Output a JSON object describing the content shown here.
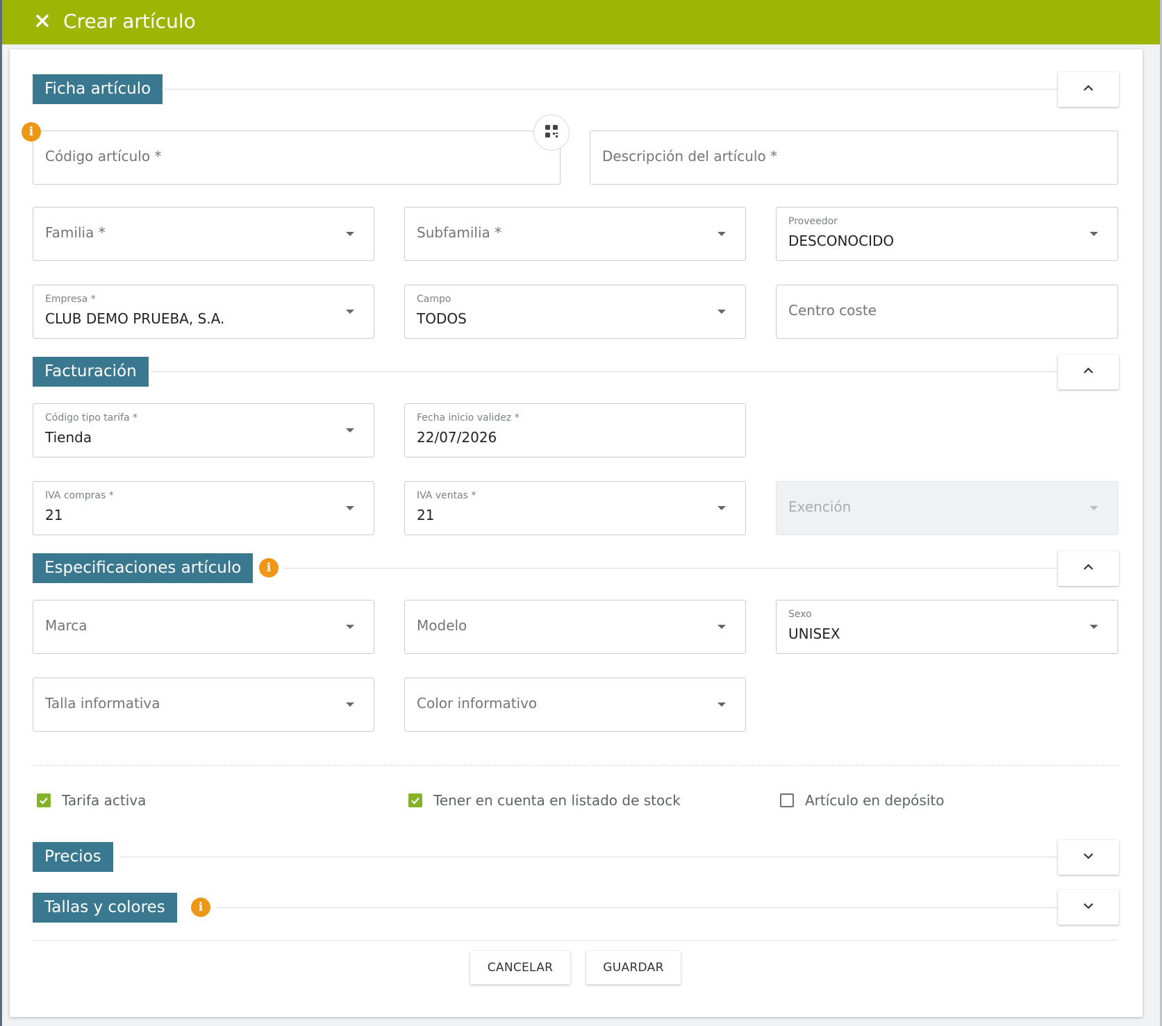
{
  "window": {
    "title": "Crear artículo"
  },
  "sections": {
    "ficha": {
      "label": "Ficha artículo"
    },
    "facturacion": {
      "label": "Facturación"
    },
    "especificaciones": {
      "label": "Especificaciones artículo"
    },
    "precios": {
      "label": "Precios"
    },
    "tallas": {
      "label": "Tallas y colores"
    }
  },
  "fields": {
    "codigo_articulo": {
      "placeholder": "Código artículo *"
    },
    "descripcion": {
      "placeholder": "Descripción del artículo *"
    },
    "familia": {
      "placeholder": "Familia *"
    },
    "subfamilia": {
      "placeholder": "Subfamilia *"
    },
    "proveedor": {
      "label": "Proveedor",
      "value": "DESCONOCIDO"
    },
    "empresa": {
      "label": "Empresa *",
      "value": "CLUB DEMO PRUEBA, S.A."
    },
    "campo": {
      "label": "Campo",
      "value": "TODOS"
    },
    "centro_coste": {
      "placeholder": "Centro coste"
    },
    "codigo_tipo_tarifa": {
      "label": "Código tipo tarifa *",
      "value": "Tienda"
    },
    "fecha_inicio_validez": {
      "label": "Fecha inicio validez *",
      "value": "22/07/2026"
    },
    "iva_compras": {
      "label": "IVA compras *",
      "value": "21"
    },
    "iva_ventas": {
      "label": "IVA ventas *",
      "value": "21"
    },
    "exencion": {
      "placeholder": "Exención"
    },
    "marca": {
      "placeholder": "Marca"
    },
    "modelo": {
      "placeholder": "Modelo"
    },
    "sexo": {
      "label": "Sexo",
      "value": "UNISEX"
    },
    "talla_informativa": {
      "placeholder": "Talla informativa"
    },
    "color_informativo": {
      "placeholder": "Color informativo"
    }
  },
  "checkboxes": {
    "tarifa_activa": {
      "label": "Tarifa activa",
      "checked": true
    },
    "listado_stock": {
      "label": "Tener en cuenta en listado de stock",
      "checked": true
    },
    "articulo_deposito": {
      "label": "Artículo en depósito",
      "checked": false
    }
  },
  "actions": {
    "cancel": "CANCELAR",
    "save": "GUARDAR"
  },
  "icons": {
    "info": "i"
  },
  "colors": {
    "header": "#9db505",
    "section_tag": "#3a7890",
    "info_badge": "#ee9716",
    "checkbox_on": "#84b228"
  }
}
